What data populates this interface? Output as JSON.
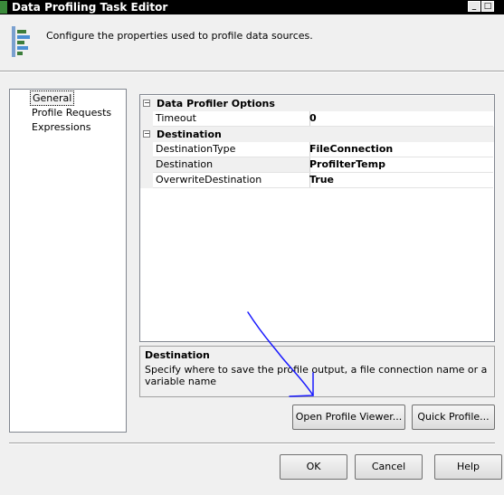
{
  "window": {
    "title": "Data Profiling Task Editor",
    "description": "Configure the properties used to profile data sources."
  },
  "left_nav": {
    "items": [
      {
        "label": "General",
        "selected": true
      },
      {
        "label": "Profile Requests",
        "selected": false
      },
      {
        "label": "Expressions",
        "selected": false
      }
    ]
  },
  "property_grid": {
    "categories": [
      {
        "name": "Data Profiler Options",
        "properties": [
          {
            "name": "Timeout",
            "value": "0"
          }
        ]
      },
      {
        "name": "Destination",
        "properties": [
          {
            "name": "DestinationType",
            "value": "FileConnection"
          },
          {
            "name": "Destination",
            "value": "ProfilterTemp"
          },
          {
            "name": "OverwriteDestination",
            "value": "True"
          }
        ]
      }
    ]
  },
  "help_panel": {
    "title": "Destination",
    "text": "Specify where to save the profile output, a file connection name or a variable name"
  },
  "buttons": {
    "open_profile_viewer": "Open Profile Viewer...",
    "quick_profile": "Quick Profile...",
    "ok": "OK",
    "cancel": "Cancel",
    "help": "Help"
  },
  "colors": {
    "titlebar": "#000000",
    "annotation_arrow": "#1a1aff"
  }
}
